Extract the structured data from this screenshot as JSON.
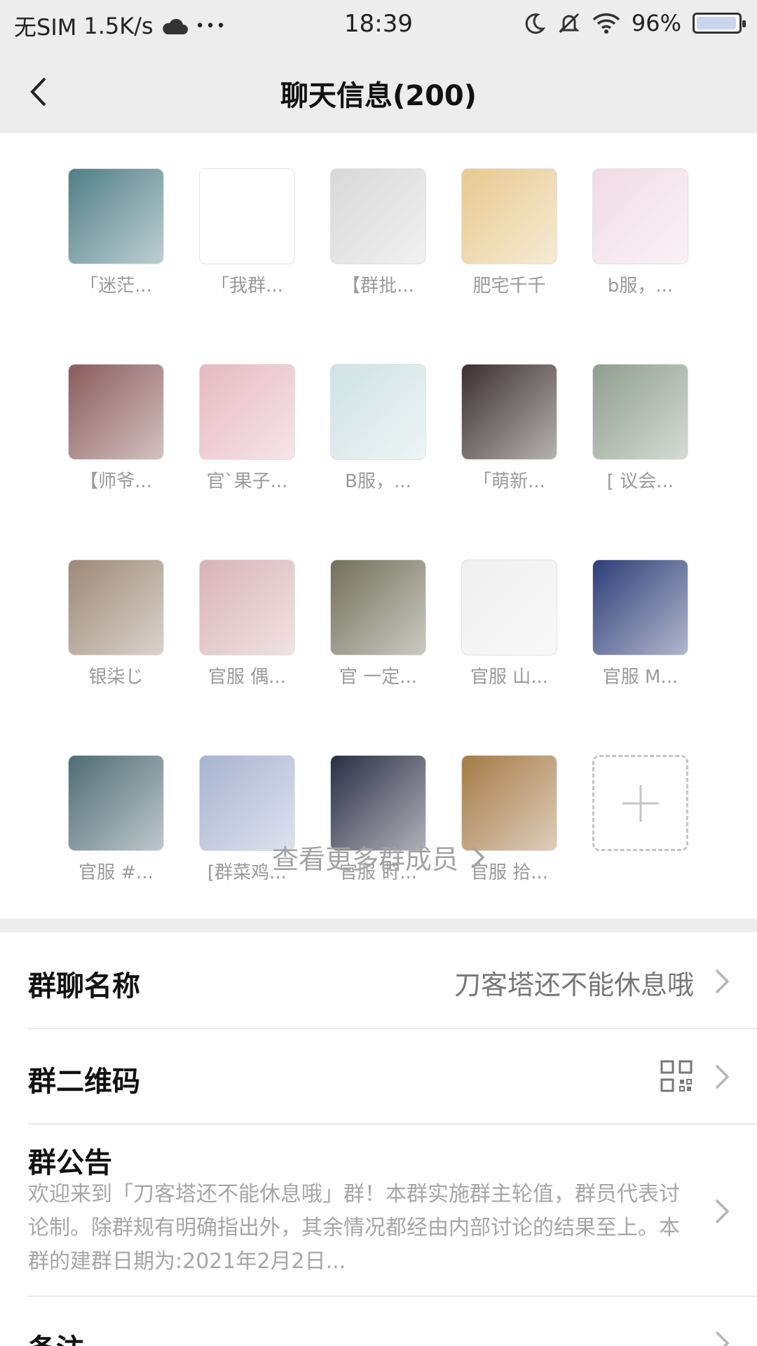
{
  "status_bar": {
    "carrier": "无SIM",
    "speed": "1.5K/s",
    "dots": "•••",
    "time": "18:39",
    "battery": "96%",
    "battery_level": 0.96
  },
  "header": {
    "title": "聊天信息(200)"
  },
  "members": [
    {
      "name": "「迷茫...",
      "color": "#4f7f86",
      "icon": "avatar-image"
    },
    {
      "name": "「我群...",
      "color": "#ffffff",
      "icon": "avatar-image"
    },
    {
      "name": "【群批...",
      "color": "#d8d8d8",
      "icon": "avatar-image"
    },
    {
      "name": "肥宅千千",
      "color": "#e8c98f",
      "icon": "avatar-image"
    },
    {
      "name": "b服，...",
      "color": "#f0dbe5",
      "icon": "avatar-image"
    },
    {
      "name": "【师爷...",
      "color": "#8a5b5b",
      "icon": "avatar-image"
    },
    {
      "name": "官`果子...",
      "color": "#e6b9c2",
      "icon": "avatar-image"
    },
    {
      "name": "B服，...",
      "color": "#cfe2e3",
      "icon": "avatar-image"
    },
    {
      "name": "「萌新...",
      "color": "#3c3030",
      "icon": "avatar-image"
    },
    {
      "name": "[ 议会...",
      "color": "#8f9e8e",
      "icon": "avatar-image"
    },
    {
      "name": "银柒じ",
      "color": "#9d8977",
      "icon": "avatar-image"
    },
    {
      "name": "官服 偶...",
      "color": "#d8b3b6",
      "icon": "avatar-image"
    },
    {
      "name": "官 一定...",
      "color": "#72705a",
      "icon": "avatar-image"
    },
    {
      "name": "官服 山...",
      "color": "#efefef",
      "icon": "avatar-image"
    },
    {
      "name": "官服 M...",
      "color": "#2e3e78",
      "icon": "avatar-image"
    },
    {
      "name": "官服 #...",
      "color": "#4f6c74",
      "icon": "avatar-image"
    },
    {
      "name": "[群菜鸡...",
      "color": "#a7b3d0",
      "icon": "avatar-image"
    },
    {
      "name": "官服 莳...",
      "color": "#2b2e44",
      "icon": "avatar-image"
    },
    {
      "name": "官服 拾...",
      "color": "#a57b47",
      "icon": "avatar-image"
    }
  ],
  "add_member": {
    "icon": "plus-icon"
  },
  "more_members": {
    "label": "查看更多群成员"
  },
  "settings": {
    "group_name": {
      "label": "群聊名称",
      "value": "刀客塔还不能休息哦"
    },
    "qr_code": {
      "label": "群二维码",
      "icon": "qr-code-icon"
    },
    "notice": {
      "label": "群公告",
      "text": "欢迎来到「刀客塔还不能休息哦」群！本群实施群主轮值，群员代表讨论制。除群规有明确指出外，其余情况都经由内部讨论的结果至上。本群的建群日期为:2021年2月2日..."
    },
    "remark": {
      "label": "备注"
    }
  }
}
